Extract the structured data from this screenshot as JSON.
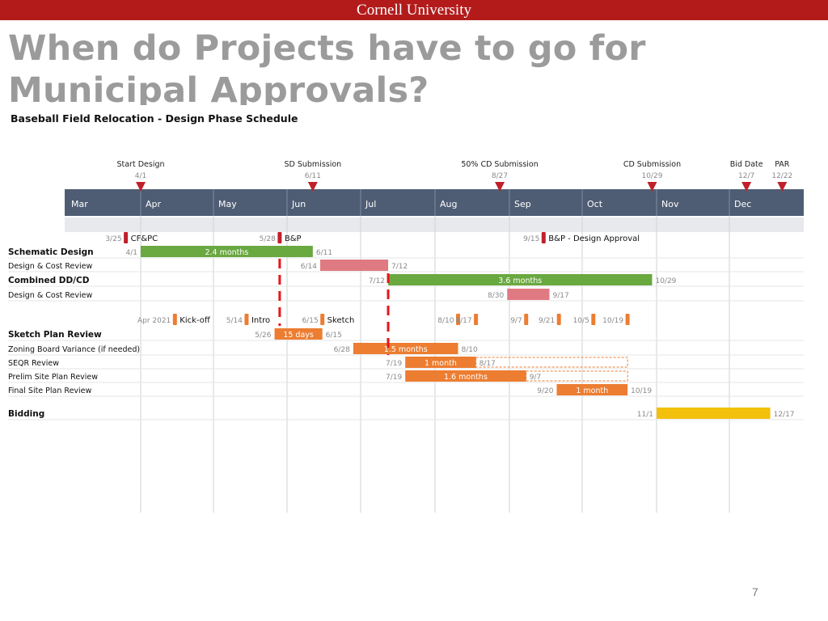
{
  "header": {
    "brand": "Cornell University"
  },
  "slide": {
    "title": "When do Projects have to go for Municipal Approvals?",
    "page_number": "7"
  },
  "colors": {
    "brand_red": "#b31b1b",
    "title_gray": "#9b9b9b",
    "month_band": "#4f5d74",
    "green_bar": "#6aa840",
    "pink_bar": "#e07a82",
    "orange_bar": "#ec7d31",
    "yellow_bar": "#f3c00c",
    "marker_red": "#c0202a",
    "dashed_red": "#e8141a"
  },
  "chart_data": {
    "type": "gantt",
    "title": "Baseball Field Relocation - Design Phase Schedule",
    "months": [
      "Mar",
      "Apr",
      "May",
      "Jun",
      "Jul",
      "Aug",
      "Sep",
      "Oct",
      "Nov",
      "Dec"
    ],
    "milestones": [
      {
        "label": "Start Design",
        "date": "4/1",
        "m": 4.0
      },
      {
        "label": "SD Submission",
        "date": "6/11",
        "m": 6.35
      },
      {
        "label": "50% CD Submission",
        "date": "8/27",
        "m": 8.87
      },
      {
        "label": "CD Submission",
        "date": "10/29",
        "m": 10.94
      },
      {
        "label": "Bid Date",
        "date": "12/7",
        "m": 12.23
      },
      {
        "label": "PAR",
        "date": "12/22",
        "m": 12.71
      }
    ],
    "events": [
      {
        "row": 1,
        "date": "3/25",
        "label": "CF&PC",
        "m": 3.8,
        "color": "red"
      },
      {
        "row": 1,
        "date": "5/28",
        "label": "B&P",
        "m": 5.9,
        "color": "red"
      },
      {
        "row": 1,
        "date": "9/15",
        "label": "B&P - Design Approval",
        "m": 9.47,
        "color": "red"
      },
      {
        "row": 7,
        "date": "Apr 2021",
        "label": "Kick-off",
        "m": 4.47,
        "color": "orange"
      },
      {
        "row": 7,
        "date": "5/14",
        "label": "Intro",
        "m": 5.45,
        "color": "orange"
      },
      {
        "row": 7,
        "date": "6/15",
        "label": "Sketch",
        "m": 6.48,
        "color": "orange"
      },
      {
        "row": 7,
        "date": "8/10",
        "label": "",
        "m": 8.31,
        "color": "orange"
      },
      {
        "row": 7,
        "date": "8/17",
        "label": "",
        "m": 8.55,
        "color": "orange"
      },
      {
        "row": 7,
        "date": "9/7",
        "label": "",
        "m": 9.23,
        "color": "orange"
      },
      {
        "row": 7,
        "date": "9/21",
        "label": "",
        "m": 9.68,
        "color": "orange"
      },
      {
        "row": 7,
        "date": "10/5",
        "label": "",
        "m": 10.15,
        "color": "orange"
      },
      {
        "row": 7,
        "date": "10/19",
        "label": "",
        "m": 10.61,
        "color": "orange"
      }
    ],
    "tasks": [
      {
        "name": "Schematic Design",
        "bold": true,
        "row": 2,
        "start": "4/1",
        "end": "6/11",
        "label": "2.4 months",
        "s": 4.0,
        "e": 6.35,
        "color": "green"
      },
      {
        "name": "Design & Cost Review",
        "bold": false,
        "row": 3,
        "start": "6/14",
        "end": "7/12",
        "label": "",
        "s": 6.45,
        "e": 7.37,
        "color": "pink"
      },
      {
        "name": "Combined DD/CD",
        "bold": true,
        "row": 4,
        "start": "7/12",
        "end": "10/29",
        "label": "3.6 months",
        "s": 7.37,
        "e": 10.94,
        "color": "green"
      },
      {
        "name": "Design & Cost Review",
        "bold": false,
        "row": 5,
        "start": "8/30",
        "end": "9/17",
        "label": "",
        "s": 8.97,
        "e": 9.55,
        "color": "pink"
      },
      {
        "name": "Sketch Plan Review",
        "bold": true,
        "row": 8,
        "start": "5/26",
        "end": "6/15",
        "label": "15 days",
        "s": 5.83,
        "e": 6.48,
        "color": "orange"
      },
      {
        "name": "Zoning Board Variance (if needed)",
        "bold": false,
        "row": 9,
        "start": "6/28",
        "end": "8/10",
        "label": "1.5 months",
        "s": 6.9,
        "e": 8.31,
        "color": "orange"
      },
      {
        "name": "SEQR Review",
        "bold": false,
        "row": 10,
        "start": "7/19",
        "end": "8/17",
        "label": "1 month",
        "s": 7.6,
        "e": 8.55,
        "color": "orange"
      },
      {
        "name": "Prelim Site Plan Review",
        "bold": false,
        "row": 11,
        "start": "7/19",
        "end": "9/7",
        "label": "1.6 months",
        "s": 7.6,
        "e": 9.23,
        "color": "orange"
      },
      {
        "name": "Final Site Plan Review",
        "bold": false,
        "row": 12,
        "start": "9/20",
        "end": "10/19",
        "label": "1 month",
        "s": 9.65,
        "e": 10.61,
        "color": "orange"
      },
      {
        "name": "Bidding",
        "bold": true,
        "row": 14,
        "start": "11/1",
        "end": "12/17",
        "label": "",
        "s": 11.0,
        "e": 12.55,
        "color": "yellow"
      }
    ],
    "dashed_outlines": [
      {
        "row": 10,
        "s": 8.55,
        "e": 10.61
      },
      {
        "row": 11,
        "s": 9.23,
        "e": 10.61
      }
    ],
    "dashed_red_lines": [
      {
        "m": 5.9,
        "from_row": 3,
        "to_row": 7
      },
      {
        "m": 7.37,
        "from_row": 4,
        "to_row": 9
      }
    ]
  }
}
